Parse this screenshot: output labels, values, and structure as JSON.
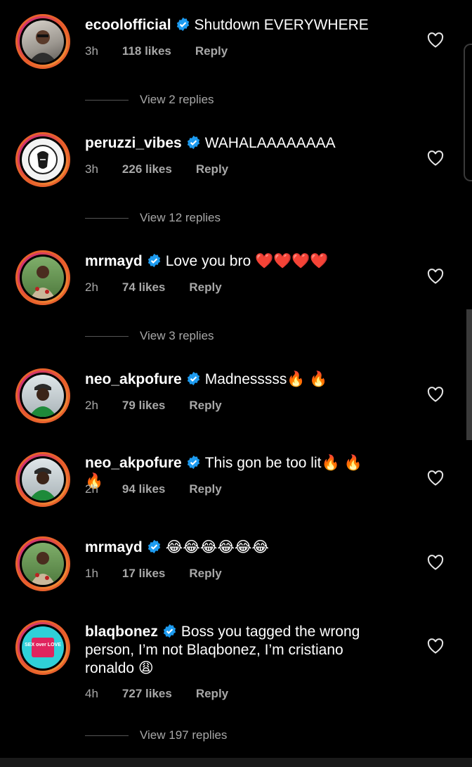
{
  "comments": [
    {
      "user": "ecoolofficial",
      "text": "Shutdown EVERYWHERE",
      "time": "3h",
      "likes": "118 likes",
      "reply": "Reply",
      "view_replies": "View 2 replies"
    },
    {
      "user": "peruzzi_vibes",
      "text": "WAHALAAAAAAAA",
      "time": "3h",
      "likes": "226 likes",
      "reply": "Reply",
      "view_replies": "View 12 replies"
    },
    {
      "user": "mrmayd",
      "text": "Love you bro ❤️❤️❤️❤️",
      "time": "2h",
      "likes": "74 likes",
      "reply": "Reply",
      "view_replies": "View 3 replies"
    },
    {
      "user": "neo_akpofure",
      "text": "Madnesssss🔥 🔥",
      "time": "2h",
      "likes": "79 likes",
      "reply": "Reply"
    },
    {
      "user": "neo_akpofure",
      "text": "This gon be too lit🔥 🔥 🔥",
      "time": "2h",
      "likes": "94 likes",
      "reply": "Reply"
    },
    {
      "user": "mrmayd",
      "text": "😂😂😂😂😂😂",
      "time": "1h",
      "likes": "17 likes",
      "reply": "Reply"
    },
    {
      "user": "blaqbonez",
      "text": "Boss you tagged the wrong person, I’m not Blaqbonez, I’m cristiano ronaldo 😩",
      "time": "4h",
      "likes": "727 likes",
      "reply": "Reply",
      "view_replies": "View 197 replies",
      "avatar_text": "SEX over LOVE"
    }
  ],
  "colors": {
    "background": "#000000",
    "verified": "#1d9bf0",
    "muted": "#a8a8a8"
  }
}
